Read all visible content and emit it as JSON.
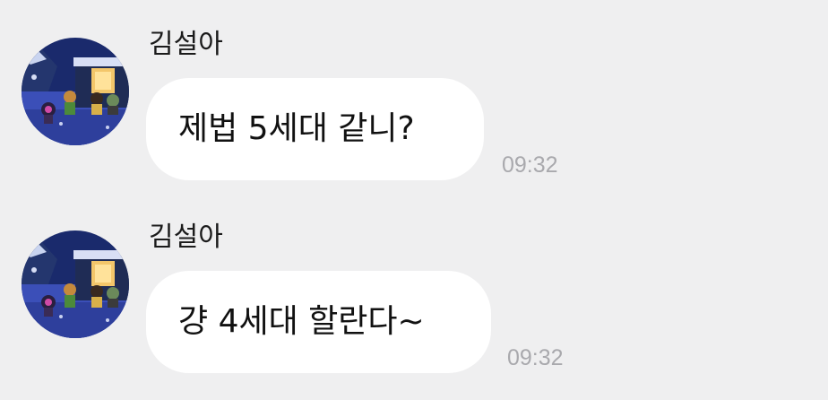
{
  "messages": [
    {
      "sender": "김설아",
      "text": "제법 5세대 같니?",
      "time": "09:32",
      "avatar_icon": "game-scene-avatar"
    },
    {
      "sender": "김설아",
      "text": "걍 4세대 할란다~",
      "time": "09:32",
      "avatar_icon": "game-scene-avatar"
    }
  ],
  "colors": {
    "background": "#EFEFF0",
    "bubble": "#FFFFFF",
    "timestamp": "#A9A9AD"
  }
}
